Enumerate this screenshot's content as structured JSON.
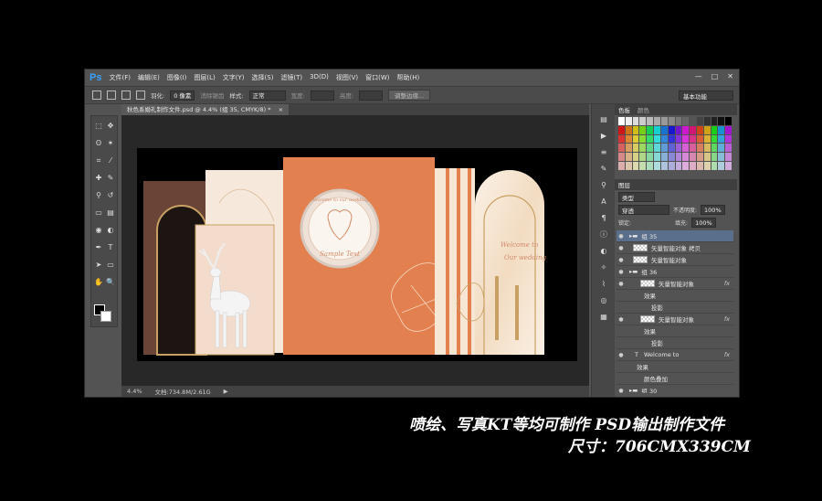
{
  "app": {
    "logo": "Ps"
  },
  "menu": [
    "文件(F)",
    "编辑(E)",
    "图像(I)",
    "图层(L)",
    "文字(Y)",
    "选择(S)",
    "滤镜(T)",
    "3D(D)",
    "视图(V)",
    "窗口(W)",
    "帮助(H)"
  ],
  "window_controls": {
    "minimize": "—",
    "restore": "□",
    "close": "✕"
  },
  "options": {
    "feather_label": "羽化:",
    "feather_value": "0 像素",
    "antialias_label": "消除锯齿",
    "style_label": "样式:",
    "style_value": "正常",
    "width_label": "宽度:",
    "height_label": "高度:",
    "refine_button": "调整边缘...",
    "workspace": "基本功能"
  },
  "document_tab": "秋色系婚礼制作文件.psd @ 4.4% (组 35, CMYK/8) *",
  "document_tab_close": "×",
  "status": {
    "zoom": "4.4%",
    "doc_info": "文档:734.8M/2.61G",
    "arrow": "▶"
  },
  "artwork": {
    "plate_top_text": "Welcome to our wedding",
    "plate_center_text": "Sample Text",
    "panel_text_1": "Welcome to",
    "panel_text_2": "Our wedding"
  },
  "color_panel": {
    "tab1": "色板",
    "tab2": "颜色"
  },
  "layers_panel": {
    "tab": "图层",
    "kind_label": "类型",
    "blend_mode": "穿透",
    "opacity_label": "不透明度:",
    "opacity_value": "100%",
    "lock_label": "锁定:",
    "fill_label": "填充:",
    "fill_value": "100%",
    "layers": [
      {
        "name": "组 35",
        "type": "group",
        "indent": 0,
        "fx": ""
      },
      {
        "name": "矢量智能对象 拷贝",
        "type": "smart",
        "indent": 0,
        "fx": ""
      },
      {
        "name": "矢量智能对象",
        "type": "smart",
        "indent": 0,
        "fx": ""
      },
      {
        "name": "组 36",
        "type": "group",
        "indent": 0,
        "fx": ""
      },
      {
        "name": "矢量智能对象",
        "type": "smart",
        "indent": 1,
        "fx": "fx"
      },
      {
        "name": "效果",
        "type": "effect",
        "indent": 2,
        "fx": ""
      },
      {
        "name": "投影",
        "type": "effect",
        "indent": 3,
        "fx": ""
      },
      {
        "name": "矢量智能对象",
        "type": "smart",
        "indent": 1,
        "fx": "fx"
      },
      {
        "name": "效果",
        "type": "effect",
        "indent": 2,
        "fx": ""
      },
      {
        "name": "投影",
        "type": "effect",
        "indent": 3,
        "fx": ""
      },
      {
        "name": "Welcome to",
        "type": "text",
        "indent": 0,
        "fx": "fx"
      },
      {
        "name": "效果",
        "type": "effect",
        "indent": 1,
        "fx": ""
      },
      {
        "name": "颜色叠加",
        "type": "effect",
        "indent": 2,
        "fx": ""
      },
      {
        "name": "组 30",
        "type": "group",
        "indent": 0,
        "fx": ""
      }
    ]
  },
  "caption": {
    "line1": "喷绘、写真KT等均可制作  PSD输出制作文件",
    "line2": "尺寸：706CMX339CM"
  },
  "colors": {
    "accent": "#e28050",
    "brown": "#6b4438",
    "cream": "#f6e6d4",
    "gold": "#c9a063"
  }
}
